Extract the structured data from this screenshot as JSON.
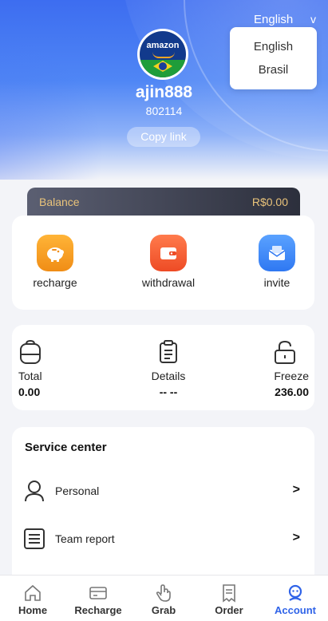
{
  "language": {
    "current": "English",
    "caret": "v",
    "options": [
      "English",
      "Brasil"
    ]
  },
  "profile": {
    "avatar_text": "amazon",
    "username": "ajin888",
    "user_id": "802114",
    "copy_link_label": "Copy link"
  },
  "balance": {
    "label": "Balance",
    "value": "R$0.00"
  },
  "actions": [
    {
      "label": "recharge",
      "icon": "piggy-bank-icon"
    },
    {
      "label": "withdrawal",
      "icon": "wallet-icon"
    },
    {
      "label": "invite",
      "icon": "mail-icon"
    }
  ],
  "stats": [
    {
      "label": "Total",
      "value": "0.00",
      "icon": "backpack-icon"
    },
    {
      "label": "Details",
      "value": "-- --",
      "icon": "clipboard-icon"
    },
    {
      "label": "Freeze",
      "value": "236.00",
      "icon": "lock-icon"
    }
  ],
  "service": {
    "title": "Service center",
    "items": [
      {
        "label": "Personal",
        "arrow": ">",
        "icon": "person-icon"
      },
      {
        "label": "Team report",
        "arrow": ">",
        "icon": "list-icon"
      }
    ]
  },
  "tabbar": {
    "items": [
      {
        "label": "Home",
        "icon": "home-icon"
      },
      {
        "label": "Recharge",
        "icon": "card-icon"
      },
      {
        "label": "Grab",
        "icon": "hand-icon"
      },
      {
        "label": "Order",
        "icon": "order-icon"
      },
      {
        "label": "Account",
        "icon": "account-icon"
      }
    ],
    "active": "Account"
  },
  "colors": {
    "accent": "#2f63e8",
    "balance_text": "#e9c37a",
    "header_blue": "#3d6df0"
  }
}
